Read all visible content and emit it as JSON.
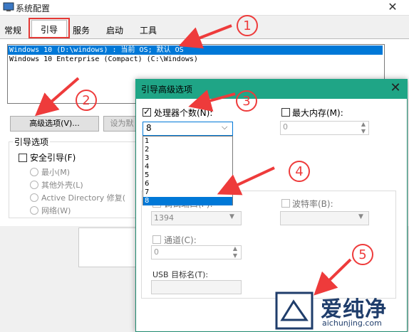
{
  "window": {
    "title": "系统配置"
  },
  "tabs": [
    "常规",
    "引导",
    "服务",
    "启动",
    "工具"
  ],
  "os_list": [
    "Windows 10 (D:\\windows) : 当前 OS; 默认 OS",
    "Windows 10 Enterprise (Compact) (C:\\Windows)"
  ],
  "buttons": {
    "advanced": "高级选项(V)...",
    "set_default": "设为默"
  },
  "boot_options": {
    "label": "引导选项",
    "safe_boot": "安全引导(F)",
    "radios": [
      "最小(M)",
      "其他外壳(L)",
      "Active Directory 修复(",
      "网络(W)"
    ]
  },
  "advanced_dialog": {
    "title": "引导高级选项",
    "num_processors_label": "处理器个数(N):",
    "num_processors_checked": true,
    "selected_value": "8",
    "dropdown_options": [
      "1",
      "2",
      "3",
      "4",
      "5",
      "6",
      "7",
      "8"
    ],
    "max_memory_label": "最大内存(M):",
    "max_memory_value": "0",
    "port_label": "调试端口(P):",
    "port_value": "1394",
    "baud_label": "波特率(B):",
    "channel_label": "通道(C):",
    "channel_value": "0",
    "usb_label": "USB 目标名(T):"
  },
  "annotations": {
    "markers": [
      "1",
      "2",
      "3",
      "4",
      "5"
    ]
  },
  "watermark": {
    "name": "爱纯净",
    "url": "aichunjing.com"
  },
  "colors": {
    "accent": "#0078d7",
    "dialog_title": "#1fa586",
    "annotation": "#ee3b3b"
  }
}
